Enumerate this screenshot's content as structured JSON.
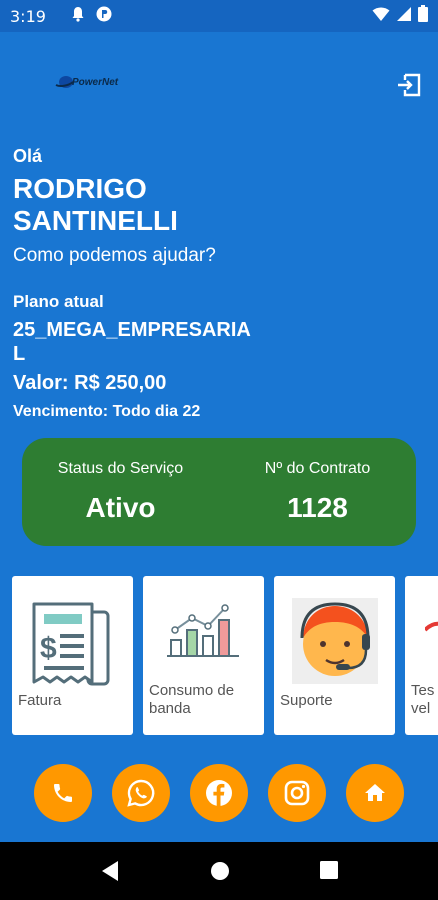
{
  "status_bar": {
    "time": "3:19"
  },
  "header": {
    "logo_text": "PowerNet"
  },
  "greeting": {
    "hello": "Olá",
    "name": "RODRIGO SANTINELLI",
    "help": "Como podemos ajudar?"
  },
  "plan": {
    "label": "Plano atual",
    "name": "25_MEGA_EMPRESARIAL",
    "value": "Valor: R$ 250,00",
    "due": "Vencimento: Todo dia 22"
  },
  "service_card": {
    "status_label": "Status do Serviço",
    "status_value": "Ativo",
    "contract_label": "Nº do Contrato",
    "contract_value": "1128"
  },
  "cards": [
    {
      "label": "Fatura",
      "icon": "invoice-icon"
    },
    {
      "label": "Consumo de banda",
      "icon": "bar-chart-icon"
    },
    {
      "label": "Suporte",
      "icon": "support-agent-icon"
    },
    {
      "label": "Tes vel",
      "icon": "speed-test-icon"
    }
  ],
  "social_buttons": [
    "phone-icon",
    "whatsapp-icon",
    "facebook-icon",
    "instagram-icon",
    "home-icon"
  ],
  "colors": {
    "background": "#1976d2",
    "status_bar": "#1565c0",
    "service_card": "#2e7d32",
    "accent": "#ff9800"
  }
}
